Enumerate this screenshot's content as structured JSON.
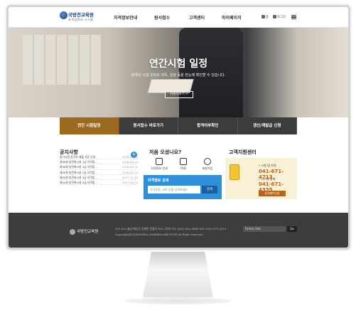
{
  "header": {
    "logo_title": "국방전교육원",
    "logo_sub": "자격검정서 시스템",
    "nav": [
      "자격정보안내",
      "원서접수",
      "고객센터",
      "마이페이지"
    ],
    "util_home": "홈",
    "util_login": "로그인"
  },
  "hero": {
    "title": "연간시험 일정",
    "subtitle": "올해의 시험 일정과 과목, 일정 등을 한눈에 확인할 수 있습니다.",
    "button": "자세히보기 >"
  },
  "quick_tabs": [
    "연간 시험일정",
    "원서접수 바로가기",
    "합격여부확인",
    "갱신/재발급 신청"
  ],
  "notice": {
    "title": "공지사항",
    "plus": "+",
    "items": [
      {
        "text": "필기시험 합격자 제출 서류 안내",
        "date": "2018-09-20"
      },
      {
        "text": "제38회 방전화시설 3급 자격증...",
        "date": "2018-08-14"
      },
      {
        "text": "제38회 방전화시설 3급 자격증...",
        "date": "2018-05-31"
      },
      {
        "text": "제36회 방전화시설 2급 자격증...",
        "date": "2018-02-23"
      },
      {
        "text": "제35회 방전화시설 3급 자격증...",
        "date": "2017-11-30"
      },
      {
        "text": "제34회 방전화시설 2급 자격증...",
        "date": "2017-09-25"
      }
    ]
  },
  "first_visit": {
    "title": "처음 오셨나요?",
    "items": [
      {
        "label": "자격정보 안내",
        "icon": "certificate-icon"
      },
      {
        "label": "FAQ",
        "icon": "faq-icon"
      },
      {
        "label": "회원가입",
        "icon": "user-icon"
      }
    ],
    "search_label": "자격정보 검색",
    "search_placeholder": "자격증명, 과목 등을 입력하세요.",
    "search_button": "검색"
  },
  "customer": {
    "title": "고객지원센터",
    "label1": "• 시험 및 자격",
    "phone1": "041-671-4713",
    "label2": "• 시스템 장애",
    "phone2": "041-671-4335",
    "button": "원격제어신청"
  },
  "footer": {
    "logo": "국방전교육원",
    "address": "357-914 충남 예산군 응봉면 응월리 831-1번지   TEL (041) 641-4969   FAX (041) 671-4214",
    "copyright": "Copyright@2018 KOREA LEARNING INSTITUTE All Right reserved.",
    "family_site": "Family Site",
    "go": "Go"
  }
}
